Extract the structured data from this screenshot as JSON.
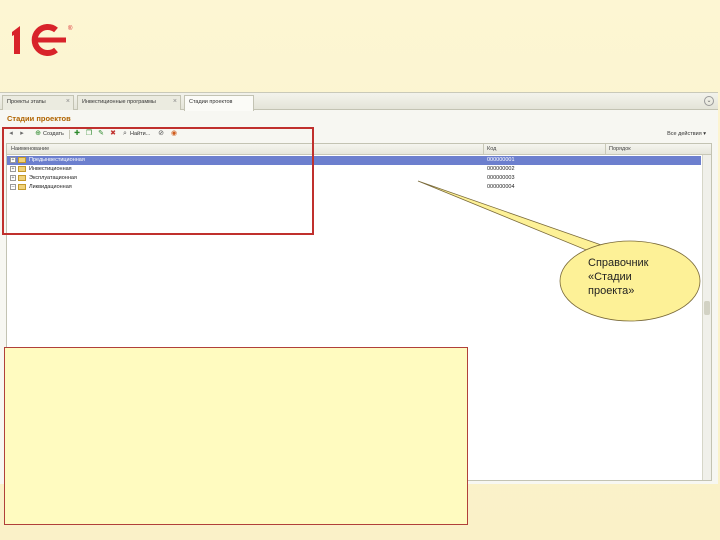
{
  "logo": {
    "text": "1С",
    "reg_mark": "®"
  },
  "tabs": [
    {
      "label": "Проекты этапы"
    },
    {
      "label": "Инвестиционные программы"
    },
    {
      "label": "Стадии проектов"
    }
  ],
  "form": {
    "title": "Стадии проектов"
  },
  "toolbar": {
    "create_label": "Создать",
    "find_label": "Найти...",
    "all_actions_label": "Все действия"
  },
  "grid": {
    "columns": [
      "Наименование",
      "Код",
      "Порядок"
    ],
    "rows": [
      {
        "name": "Предынвестиционная",
        "code": "000000001"
      },
      {
        "name": "Инвестиционная",
        "code": "000000002"
      },
      {
        "name": "Эксплуатационная",
        "code": "000000003"
      },
      {
        "name": "Ликвидационная",
        "code": "000000004"
      }
    ]
  },
  "callout": {
    "line1": "Справочник",
    "line2": "«Стадии",
    "line3": "проекта»"
  },
  "colors": {
    "accent_orange": "#b06400",
    "selection_blue": "#6c7fce",
    "highlight_red": "#c0302d",
    "callout_fill": "#fdf197"
  }
}
